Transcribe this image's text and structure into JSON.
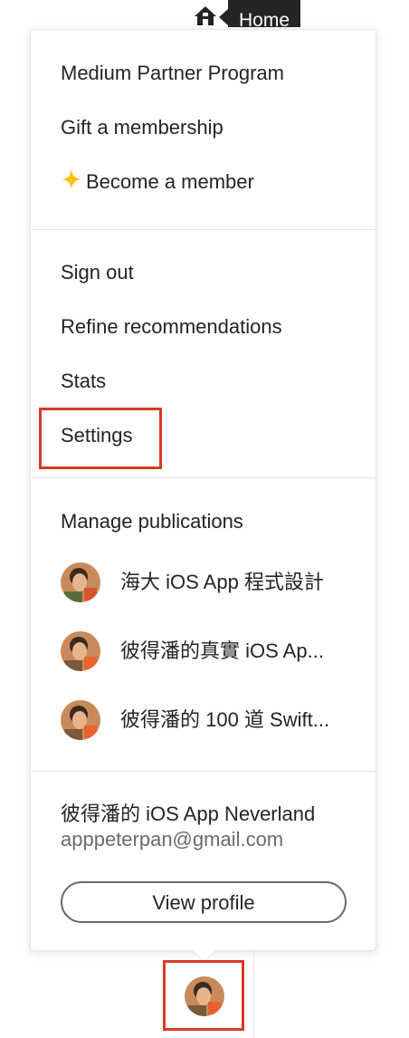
{
  "header": {
    "home_icon": "home-icon",
    "home_label": "Home"
  },
  "menu": {
    "section1": [
      "Medium Partner Program",
      "Gift a membership",
      "Become a member"
    ],
    "section2": [
      "Sign out",
      "Refine recommendations",
      "Stats",
      "Settings"
    ],
    "publications_heading": "Manage publications",
    "publications": [
      {
        "name": "海大 iOS App 程式設計",
        "icon": "avatar"
      },
      {
        "name": "彼得潘的真實 iOS Ap...",
        "icon": "avatar"
      },
      {
        "name": "彼得潘的 100 道 Swift...",
        "icon": "avatar"
      }
    ],
    "user": {
      "name": "彼得潘的 iOS App Neverland",
      "email": "apppeterpan@gmail.com",
      "view_profile": "View profile"
    }
  },
  "colors": {
    "highlight": "#d93a24",
    "sparkle": "#ffc017"
  }
}
